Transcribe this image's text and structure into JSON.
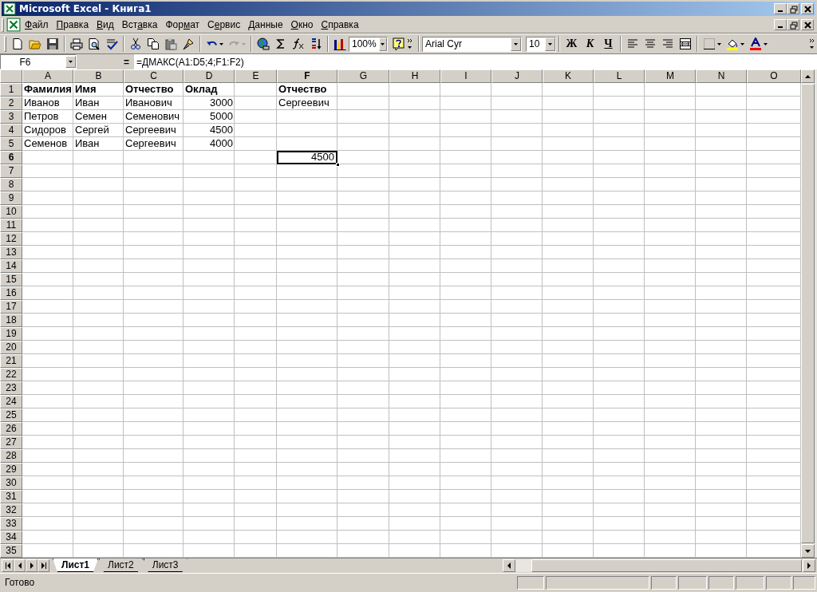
{
  "window": {
    "title": "Microsoft Excel - Книга1"
  },
  "menu": [
    {
      "key": "Ф",
      "after": "айл"
    },
    {
      "key": "П",
      "after": "равка"
    },
    {
      "key": "В",
      "after": "ид"
    },
    {
      "before": "Вст",
      "key": "а",
      "after": "вка"
    },
    {
      "before": "Фор",
      "key": "м",
      "after": "ат"
    },
    {
      "before": "С",
      "key": "е",
      "after": "рвис"
    },
    {
      "key": "Д",
      "after": "анные"
    },
    {
      "key": "О",
      "after": "кно"
    },
    {
      "key": "С",
      "after": "правка"
    }
  ],
  "toolbar": {
    "zoom": "100%",
    "font": "Arial Cyr",
    "font_size": "10",
    "format_buttons": [
      "Ж",
      "К",
      "Ч"
    ]
  },
  "formula_bar": {
    "name_box": "F6",
    "equals": "=",
    "formula": "=ДМАКС(A1:D5;4;F1:F2)"
  },
  "sheet": {
    "columns": [
      {
        "label": "A",
        "selected": false
      },
      {
        "label": "B",
        "selected": false
      },
      {
        "label": "C",
        "selected": false
      },
      {
        "label": "D",
        "selected": false
      },
      {
        "label": "E",
        "selected": false
      },
      {
        "label": "F",
        "selected": true
      },
      {
        "label": "G",
        "selected": false
      },
      {
        "label": "H",
        "selected": false
      },
      {
        "label": "I",
        "selected": false
      },
      {
        "label": "J",
        "selected": false
      },
      {
        "label": "K",
        "selected": false
      },
      {
        "label": "L",
        "selected": false
      },
      {
        "label": "M",
        "selected": false
      },
      {
        "label": "N",
        "selected": false
      },
      {
        "label": "O",
        "selected": false
      }
    ],
    "rows": [
      {
        "number": "1",
        "selected": false,
        "cells": [
          {
            "text": "Фамилия",
            "bold": true,
            "kind": "text",
            "selected": false
          },
          {
            "text": "Имя",
            "bold": true,
            "kind": "text",
            "selected": false
          },
          {
            "text": "Отчество",
            "bold": true,
            "kind": "text",
            "selected": false
          },
          {
            "text": "Оклад",
            "bold": true,
            "kind": "text",
            "selected": false
          },
          null,
          {
            "text": "Отчество",
            "bold": true,
            "kind": "text",
            "selected": false
          }
        ]
      },
      {
        "number": "2",
        "selected": false,
        "cells": [
          {
            "text": "Иванов",
            "bold": false,
            "kind": "text",
            "selected": false
          },
          {
            "text": "Иван",
            "bold": false,
            "kind": "text",
            "selected": false
          },
          {
            "text": "Иванович",
            "bold": false,
            "kind": "text",
            "selected": false
          },
          {
            "text": "3000",
            "bold": false,
            "kind": "number",
            "selected": false
          },
          null,
          {
            "text": "Сергеевич",
            "bold": false,
            "kind": "text",
            "selected": false
          }
        ]
      },
      {
        "number": "3",
        "selected": false,
        "cells": [
          {
            "text": "Петров",
            "bold": false,
            "kind": "text",
            "selected": false
          },
          {
            "text": "Семен",
            "bold": false,
            "kind": "text",
            "selected": false
          },
          {
            "text": "Семенович",
            "bold": false,
            "kind": "text",
            "selected": false
          },
          {
            "text": "5000",
            "bold": false,
            "kind": "number",
            "selected": false
          }
        ]
      },
      {
        "number": "4",
        "selected": false,
        "cells": [
          {
            "text": "Сидоров",
            "bold": false,
            "kind": "text",
            "selected": false
          },
          {
            "text": "Сергей",
            "bold": false,
            "kind": "text",
            "selected": false
          },
          {
            "text": "Сергеевич",
            "bold": false,
            "kind": "text",
            "selected": false
          },
          {
            "text": "4500",
            "bold": false,
            "kind": "number",
            "selected": false
          }
        ]
      },
      {
        "number": "5",
        "selected": false,
        "cells": [
          {
            "text": "Семенов",
            "bold": false,
            "kind": "text",
            "selected": false
          },
          {
            "text": "Иван",
            "bold": false,
            "kind": "text",
            "selected": false
          },
          {
            "text": "Сергеевич",
            "bold": false,
            "kind": "text",
            "selected": false
          },
          {
            "text": "4000",
            "bold": false,
            "kind": "number",
            "selected": false
          }
        ]
      },
      {
        "number": "6",
        "selected": true,
        "cells": [
          null,
          null,
          null,
          null,
          null,
          {
            "text": "4500",
            "bold": false,
            "kind": "number",
            "selected": true
          }
        ]
      },
      {
        "number": "7",
        "selected": false
      },
      {
        "number": "8",
        "selected": false
      },
      {
        "number": "9",
        "selected": false
      },
      {
        "number": "10",
        "selected": false
      },
      {
        "number": "11",
        "selected": false
      },
      {
        "number": "12",
        "selected": false
      },
      {
        "number": "13",
        "selected": false
      },
      {
        "number": "14",
        "selected": false
      },
      {
        "number": "15",
        "selected": false
      },
      {
        "number": "16",
        "selected": false
      },
      {
        "number": "17",
        "selected": false
      },
      {
        "number": "18",
        "selected": false
      },
      {
        "number": "19",
        "selected": false
      },
      {
        "number": "20",
        "selected": false
      },
      {
        "number": "21",
        "selected": false
      },
      {
        "number": "22",
        "selected": false
      },
      {
        "number": "23",
        "selected": false
      },
      {
        "number": "24",
        "selected": false
      },
      {
        "number": "25",
        "selected": false
      },
      {
        "number": "26",
        "selected": false
      },
      {
        "number": "27",
        "selected": false
      },
      {
        "number": "28",
        "selected": false
      },
      {
        "number": "29",
        "selected": false
      },
      {
        "number": "30",
        "selected": false
      },
      {
        "number": "31",
        "selected": false
      },
      {
        "number": "32",
        "selected": false
      },
      {
        "number": "33",
        "selected": false
      },
      {
        "number": "34",
        "selected": false
      },
      {
        "number": "35",
        "selected": false
      }
    ]
  },
  "sheet_tabs": [
    {
      "label": "Лист1",
      "selected": true
    },
    {
      "label": "Лист2",
      "selected": false
    },
    {
      "label": "Лист3",
      "selected": false
    }
  ],
  "status_bar": {
    "text": "Готово"
  }
}
